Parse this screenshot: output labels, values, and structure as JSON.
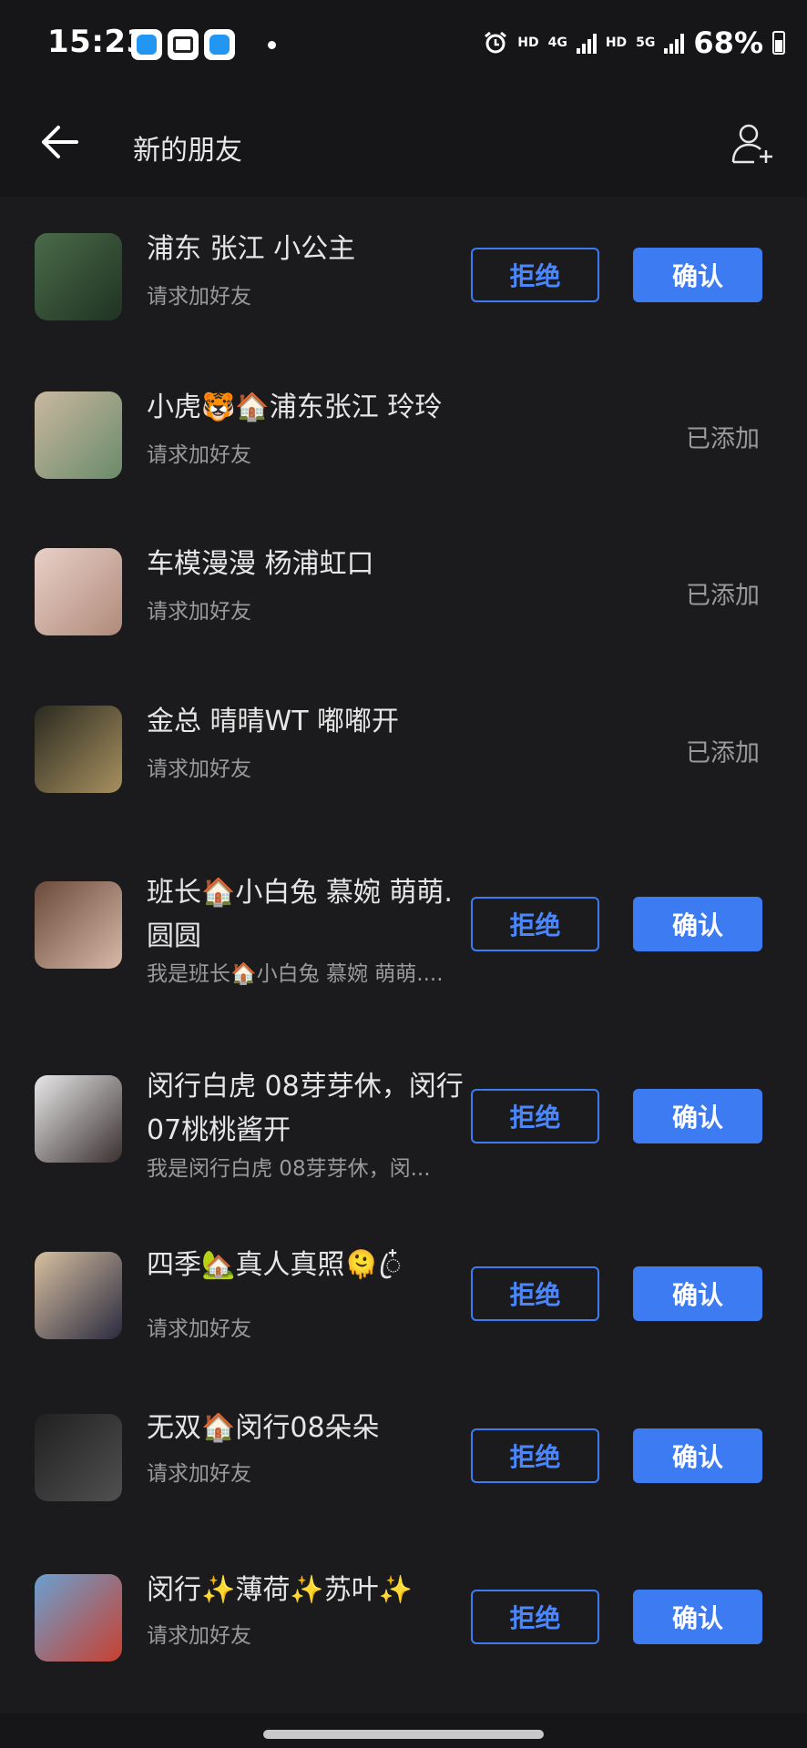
{
  "status_bar": {
    "time": "15:23",
    "network_1": "HD",
    "network_2": "4G",
    "network_3": "HD",
    "network_4": "5G",
    "battery": "68%"
  },
  "header": {
    "title": "新的朋友",
    "back_icon": "arrow-left-icon",
    "add_icon": "add-user-icon"
  },
  "buttons": {
    "reject": "拒绝",
    "confirm": "确认",
    "added": "已添加"
  },
  "requests": [
    {
      "name": "浦东 张江 小公主",
      "message": "请求加好友",
      "status": "pending"
    },
    {
      "name": "小虎🐯🏠浦东张江 玲玲",
      "message": "请求加好友",
      "status": "added"
    },
    {
      "name": "车模漫漫 杨浦虹口",
      "message": "请求加好友",
      "status": "added"
    },
    {
      "name": "金总  晴晴WT  嘟嘟开",
      "message": "请求加好友",
      "status": "added"
    },
    {
      "name": "班长🏠小白兔 慕婉 萌萌.圆圆",
      "message": "我是班长🏠小白兔 慕婉 萌萌....",
      "status": "pending"
    },
    {
      "name": "闵行白虎 08芽芽休，闵行07桃桃酱开",
      "message": "我是闵行白虎 08芽芽休，闵...",
      "status": "pending"
    },
    {
      "name": "四季🏡真人真照🫠ꦿ໋",
      "message": "请求加好友",
      "status": "pending"
    },
    {
      "name": "无双🏠闵行08朵朵",
      "message": "请求加好友",
      "status": "pending"
    },
    {
      "name": "闵行✨薄荷✨苏叶✨",
      "message": "请求加好友",
      "status": "pending"
    }
  ]
}
